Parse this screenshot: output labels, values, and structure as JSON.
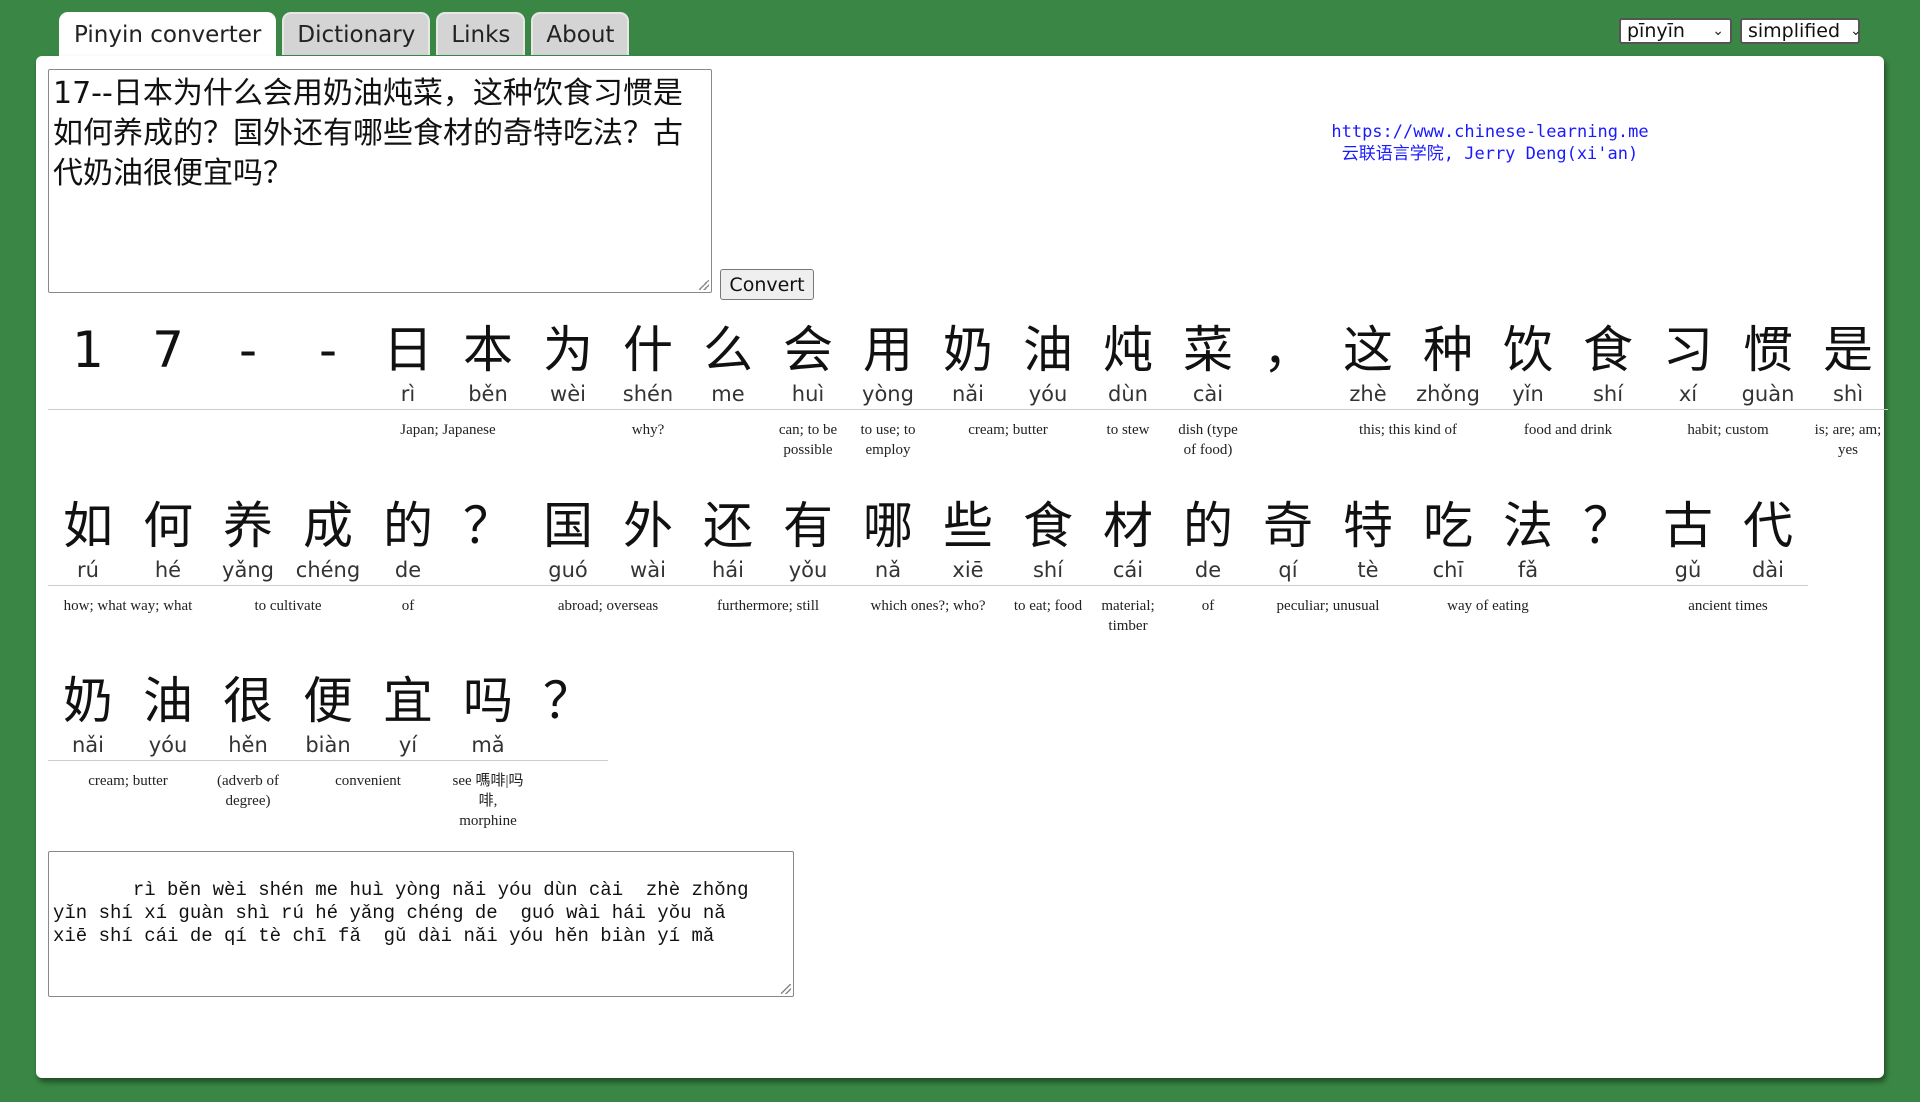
{
  "tabs": [
    {
      "label": "Pinyin converter",
      "active": true
    },
    {
      "label": "Dictionary",
      "active": false
    },
    {
      "label": "Links",
      "active": false
    },
    {
      "label": "About",
      "active": false
    }
  ],
  "selects": {
    "tone_mode": "pīnyīn",
    "script": "simplified"
  },
  "input_text": "17--日本为什么会用奶油炖菜，这种饮食习惯是如何养成的？国外还有哪些食材的奇特吃法？古代奶油很便宜吗？",
  "convert_label": "Convert",
  "credit": {
    "url": "https://www.chinese-learning.me",
    "author": "云联语言学院, Jerry Deng(xi'an)"
  },
  "rows": [
    {
      "chars": [
        {
          "c": "1",
          "p": ""
        },
        {
          "c": "7",
          "p": ""
        },
        {
          "c": "-",
          "p": ""
        },
        {
          "c": "-",
          "p": ""
        },
        {
          "c": "日",
          "p": "rì"
        },
        {
          "c": "本",
          "p": "běn"
        },
        {
          "c": "为",
          "p": "wèi"
        },
        {
          "c": "什",
          "p": "shén"
        },
        {
          "c": "么",
          "p": "me"
        },
        {
          "c": "会",
          "p": "huì"
        },
        {
          "c": "用",
          "p": "yòng"
        },
        {
          "c": "奶",
          "p": "nǎi"
        },
        {
          "c": "油",
          "p": "yóu"
        },
        {
          "c": "炖",
          "p": "dùn"
        },
        {
          "c": "菜",
          "p": "cài"
        },
        {
          "c": "，",
          "p": ""
        },
        {
          "c": "这",
          "p": "zhè"
        },
        {
          "c": "种",
          "p": "zhǒng"
        },
        {
          "c": "饮",
          "p": "yǐn"
        },
        {
          "c": "食",
          "p": "shí"
        },
        {
          "c": "习",
          "p": "xí"
        },
        {
          "c": "惯",
          "p": "guàn"
        },
        {
          "c": "是",
          "p": "shì"
        }
      ],
      "glosses": [
        {
          "start": 4,
          "span": 2,
          "text": "Japan; Japanese"
        },
        {
          "start": 6,
          "span": 3,
          "text": "why?"
        },
        {
          "start": 9,
          "span": 1,
          "text": "can; to be possible"
        },
        {
          "start": 10,
          "span": 1,
          "text": "to use; to employ"
        },
        {
          "start": 11,
          "span": 2,
          "text": "cream; butter"
        },
        {
          "start": 13,
          "span": 1,
          "text": "to stew"
        },
        {
          "start": 14,
          "span": 1,
          "text": "dish (type of food)"
        },
        {
          "start": 16,
          "span": 2,
          "text": "this; this kind of"
        },
        {
          "start": 18,
          "span": 2,
          "text": "food and drink"
        },
        {
          "start": 20,
          "span": 2,
          "text": "habit; custom"
        },
        {
          "start": 22,
          "span": 1,
          "text": "is; are; am; yes"
        }
      ]
    },
    {
      "chars": [
        {
          "c": "如",
          "p": "rú"
        },
        {
          "c": "何",
          "p": "hé"
        },
        {
          "c": "养",
          "p": "yǎng"
        },
        {
          "c": "成",
          "p": "chéng"
        },
        {
          "c": "的",
          "p": "de"
        },
        {
          "c": "？",
          "p": ""
        },
        {
          "c": "国",
          "p": "guó"
        },
        {
          "c": "外",
          "p": "wài"
        },
        {
          "c": "还",
          "p": "hái"
        },
        {
          "c": "有",
          "p": "yǒu"
        },
        {
          "c": "哪",
          "p": "nǎ"
        },
        {
          "c": "些",
          "p": "xiē"
        },
        {
          "c": "食",
          "p": "shí"
        },
        {
          "c": "材",
          "p": "cái"
        },
        {
          "c": "的",
          "p": "de"
        },
        {
          "c": "奇",
          "p": "qí"
        },
        {
          "c": "特",
          "p": "tè"
        },
        {
          "c": "吃",
          "p": "chī"
        },
        {
          "c": "法",
          "p": "fǎ"
        },
        {
          "c": "？",
          "p": ""
        },
        {
          "c": "古",
          "p": "gǔ"
        },
        {
          "c": "代",
          "p": "dài"
        }
      ],
      "glosses": [
        {
          "start": 0,
          "span": 2,
          "text": "how; what way; what"
        },
        {
          "start": 2,
          "span": 2,
          "text": "to cultivate"
        },
        {
          "start": 4,
          "span": 1,
          "text": "of"
        },
        {
          "start": 6,
          "span": 2,
          "text": "abroad; overseas"
        },
        {
          "start": 8,
          "span": 2,
          "text": "furthermore; still"
        },
        {
          "start": 10,
          "span": 2,
          "text": "which ones?; who?"
        },
        {
          "start": 12,
          "span": 1,
          "text": "to eat; food"
        },
        {
          "start": 13,
          "span": 1,
          "text": "material; timber"
        },
        {
          "start": 14,
          "span": 1,
          "text": "of"
        },
        {
          "start": 15,
          "span": 2,
          "text": "peculiar; unusual"
        },
        {
          "start": 17,
          "span": 2,
          "text": "way of eating"
        },
        {
          "start": 20,
          "span": 2,
          "text": "ancient times"
        }
      ]
    },
    {
      "chars": [
        {
          "c": "奶",
          "p": "nǎi"
        },
        {
          "c": "油",
          "p": "yóu"
        },
        {
          "c": "很",
          "p": "hěn"
        },
        {
          "c": "便",
          "p": "biàn"
        },
        {
          "c": "宜",
          "p": "yí"
        },
        {
          "c": "吗",
          "p": "mǎ"
        },
        {
          "c": "？",
          "p": ""
        }
      ],
      "glosses": [
        {
          "start": 0,
          "span": 2,
          "text": "cream; butter"
        },
        {
          "start": 2,
          "span": 1,
          "text": "(adverb of degree)"
        },
        {
          "start": 3,
          "span": 2,
          "text": "convenient"
        },
        {
          "start": 5,
          "span": 1,
          "text": "see 嗎啡|吗啡, morphine"
        }
      ]
    }
  ],
  "output_text": "   rì běn wèi shén me huì yòng nǎi yóu dùn cài  zhè zhǒng\nyǐn shí xí guàn shì rú hé yǎng chéng de  guó wài hái yǒu nǎ\nxiē shí cái de qí tè chī fǎ  gǔ dài nǎi yóu hěn biàn yí mǎ"
}
